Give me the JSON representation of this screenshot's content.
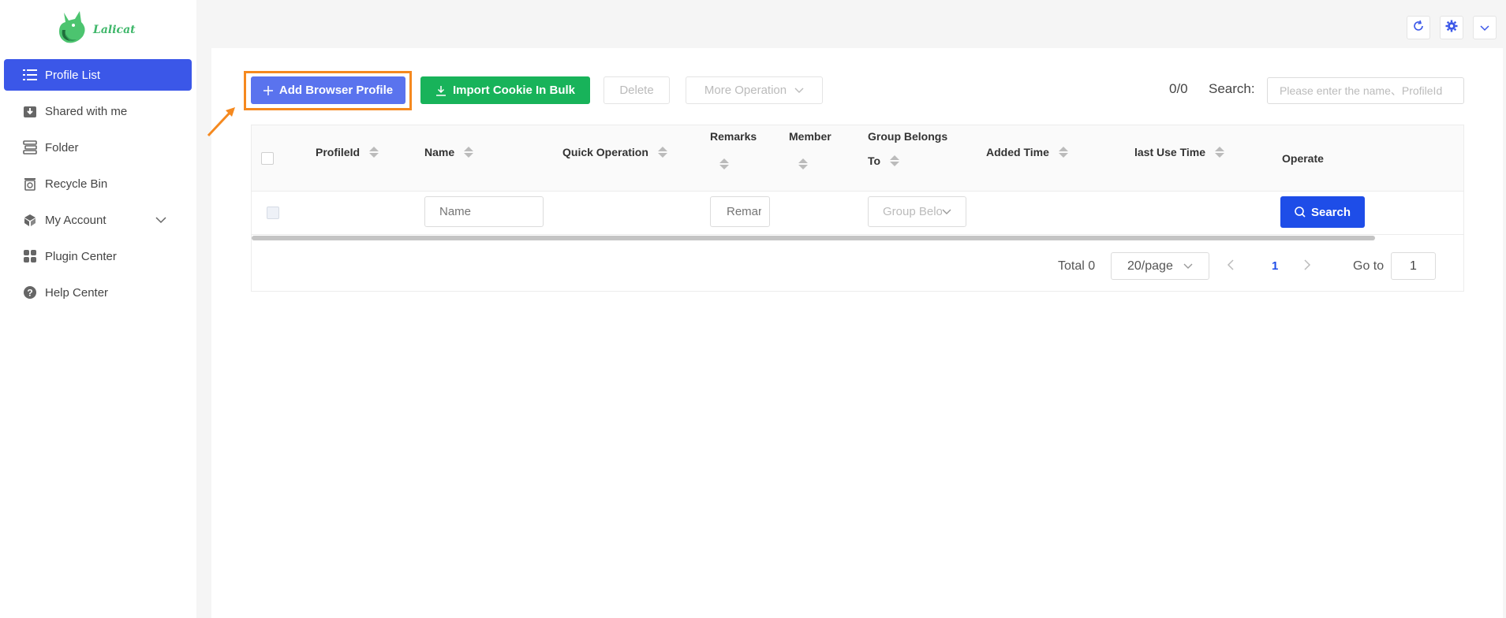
{
  "app": {
    "name": "Lalicat",
    "accent": "#3b57e8",
    "highlight": "#f5891f"
  },
  "sidebar": {
    "items": [
      {
        "label": "Profile List",
        "icon": "list-icon",
        "active": true
      },
      {
        "label": "Shared with me",
        "icon": "download-box-icon"
      },
      {
        "label": "Folder",
        "icon": "folder-stack-icon"
      },
      {
        "label": "Recycle Bin",
        "icon": "recycle-bin-icon"
      },
      {
        "label": "My Account",
        "icon": "account-cubes-icon",
        "expandable": true
      },
      {
        "label": "Plugin Center",
        "icon": "grid-icon"
      },
      {
        "label": "Help Center",
        "icon": "help-icon"
      }
    ]
  },
  "topbar": {
    "icons": [
      "refresh-icon",
      "settings-icon",
      "chevron-down-icon"
    ]
  },
  "toolbar": {
    "add_label": "Add Browser Profile",
    "import_label": "Import Cookie In Bulk",
    "delete_label": "Delete",
    "more_label": "More Operation",
    "count": "0/0",
    "search_label": "Search:",
    "search_placeholder": "Please enter the name、ProfileId"
  },
  "table": {
    "columns": {
      "profileid": "ProfileId",
      "name": "Name",
      "quick": "Quick Operation",
      "remarks": "Remarks",
      "member": "Member",
      "group_line1": "Group Belongs",
      "group_line2": "To",
      "added": "Added Time",
      "lastuse": "last Use Time",
      "operate": "Operate"
    },
    "filters": {
      "name_placeholder": "Name",
      "remarks_placeholder": "Remarks",
      "group_placeholder": "Group Belongs To",
      "search_button": "Search"
    }
  },
  "pagination": {
    "total": "Total 0",
    "per_page": "20/page",
    "current_page": "1",
    "goto_label": "Go to",
    "goto_value": "1"
  }
}
